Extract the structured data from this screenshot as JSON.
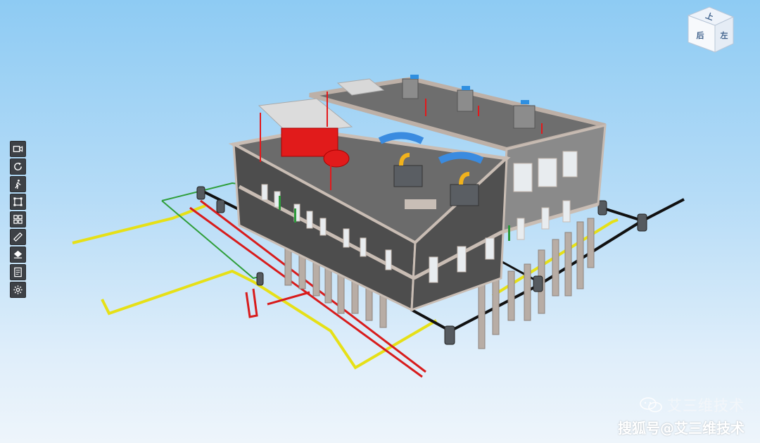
{
  "toolbar": {
    "buttons": [
      {
        "name": "camera-icon"
      },
      {
        "name": "rotate-icon"
      },
      {
        "name": "walk-icon"
      },
      {
        "name": "fit-bounds-icon"
      },
      {
        "name": "model-tree-icon"
      },
      {
        "name": "measure-icon"
      },
      {
        "name": "section-icon"
      },
      {
        "name": "properties-icon"
      },
      {
        "name": "settings-icon"
      }
    ]
  },
  "viewcube": {
    "top_label": "上",
    "back_label": "后",
    "left_label": "左"
  },
  "watermark": {
    "channel": "艾三维技术",
    "source": "搜狐号@艾三维技术"
  },
  "colors": {
    "accent_red": "#e3191c",
    "pipe_yellow": "#e6e017",
    "pipe_green": "#2f9e3a",
    "toolbar_bg": "#3d4146"
  }
}
